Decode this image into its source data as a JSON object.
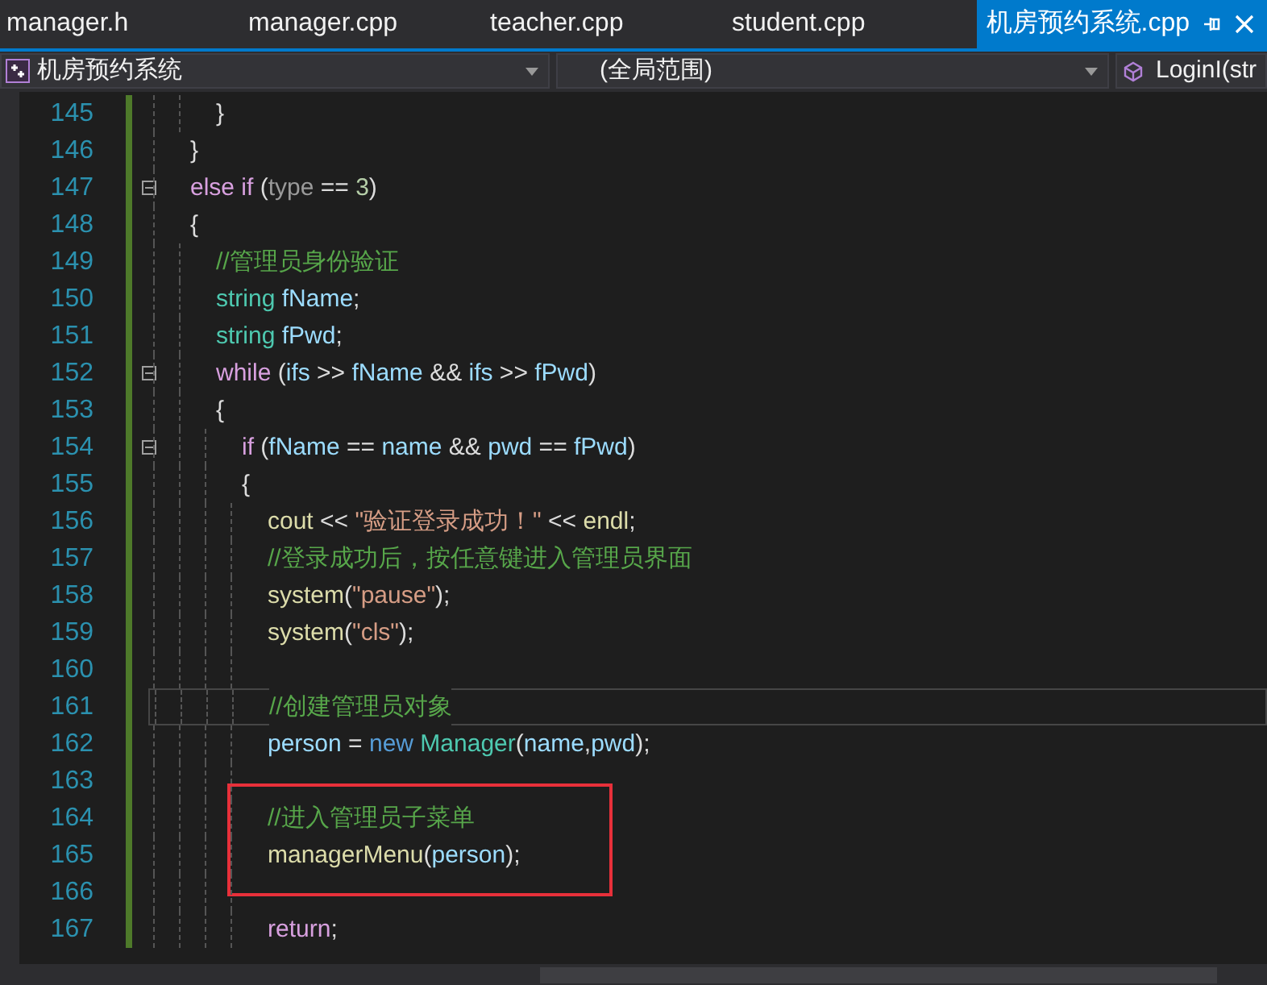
{
  "tabs": [
    {
      "label": "manager.h",
      "selected": false
    },
    {
      "label": "manager.cpp",
      "selected": false
    },
    {
      "label": "teacher.cpp",
      "selected": false
    },
    {
      "label": "student.cpp",
      "selected": false
    },
    {
      "label": "机房预约系统.cpp",
      "selected": true
    }
  ],
  "navigation": {
    "project": "机房预约系统",
    "scope": "(全局范围)",
    "member": "LoginI(str"
  },
  "editor": {
    "lines": [
      {
        "number": "145",
        "kind": "body",
        "fold": false,
        "current": false,
        "boxed": false,
        "tokens": [
          {
            "kind": "plain",
            "text": "}"
          }
        ]
      },
      {
        "number": "146",
        "kind": "outer",
        "fold": false,
        "current": false,
        "boxed": false,
        "tokens": [
          {
            "kind": "plain",
            "text": "}"
          }
        ]
      },
      {
        "number": "147",
        "kind": "outer",
        "fold": true,
        "current": false,
        "boxed": false,
        "tokens": [
          {
            "kind": "control",
            "text": "else if"
          },
          {
            "kind": "plain",
            "text": " ("
          },
          {
            "kind": "param",
            "text": "type"
          },
          {
            "kind": "plain",
            "text": " == "
          },
          {
            "kind": "number",
            "text": "3"
          },
          {
            "kind": "plain",
            "text": ")"
          }
        ]
      },
      {
        "number": "148",
        "kind": "outer",
        "fold": false,
        "current": false,
        "boxed": false,
        "tokens": [
          {
            "kind": "plain",
            "text": "{"
          }
        ]
      },
      {
        "number": "149",
        "kind": "body",
        "fold": false,
        "current": false,
        "boxed": false,
        "tokens": [
          {
            "kind": "comment",
            "text": "//管理员身份验证"
          }
        ]
      },
      {
        "number": "150",
        "kind": "body",
        "fold": false,
        "current": false,
        "boxed": false,
        "tokens": [
          {
            "kind": "type",
            "text": "string"
          },
          {
            "kind": "variable",
            "text": " fName"
          },
          {
            "kind": "plain",
            "text": ";"
          }
        ]
      },
      {
        "number": "151",
        "kind": "body",
        "fold": false,
        "current": false,
        "boxed": false,
        "tokens": [
          {
            "kind": "type",
            "text": "string"
          },
          {
            "kind": "variable",
            "text": " fPwd"
          },
          {
            "kind": "plain",
            "text": ";"
          }
        ]
      },
      {
        "number": "152",
        "kind": "body",
        "fold": true,
        "current": false,
        "boxed": false,
        "tokens": [
          {
            "kind": "control",
            "text": "while"
          },
          {
            "kind": "plain",
            "text": " ("
          },
          {
            "kind": "variable",
            "text": "ifs"
          },
          {
            "kind": "plain",
            "text": " >> "
          },
          {
            "kind": "variable",
            "text": "fName"
          },
          {
            "kind": "plain",
            "text": " && "
          },
          {
            "kind": "variable",
            "text": "ifs"
          },
          {
            "kind": "plain",
            "text": " >> "
          },
          {
            "kind": "variable",
            "text": "fPwd"
          },
          {
            "kind": "plain",
            "text": ")"
          }
        ]
      },
      {
        "number": "153",
        "kind": "body",
        "fold": false,
        "current": false,
        "boxed": false,
        "tokens": [
          {
            "kind": "plain",
            "text": "{"
          }
        ]
      },
      {
        "number": "154",
        "kind": "inner",
        "fold": true,
        "current": false,
        "boxed": false,
        "tokens": [
          {
            "kind": "control",
            "text": "if"
          },
          {
            "kind": "plain",
            "text": " ("
          },
          {
            "kind": "variable",
            "text": "fName"
          },
          {
            "kind": "plain",
            "text": " == "
          },
          {
            "kind": "variable",
            "text": "name"
          },
          {
            "kind": "plain",
            "text": " && "
          },
          {
            "kind": "variable",
            "text": "pwd"
          },
          {
            "kind": "plain",
            "text": " == "
          },
          {
            "kind": "variable",
            "text": "fPwd"
          },
          {
            "kind": "plain",
            "text": ")"
          }
        ]
      },
      {
        "number": "155",
        "kind": "inner",
        "fold": false,
        "current": false,
        "boxed": false,
        "tokens": [
          {
            "kind": "plain",
            "text": "{"
          }
        ]
      },
      {
        "number": "156",
        "kind": "deep",
        "fold": false,
        "current": false,
        "boxed": false,
        "tokens": [
          {
            "kind": "function",
            "text": "cout"
          },
          {
            "kind": "plain",
            "text": " << "
          },
          {
            "kind": "string",
            "text": "\"验证登录成功！\""
          },
          {
            "kind": "plain",
            "text": " << "
          },
          {
            "kind": "function",
            "text": "endl"
          },
          {
            "kind": "plain",
            "text": ";"
          }
        ]
      },
      {
        "number": "157",
        "kind": "deep",
        "fold": false,
        "current": false,
        "boxed": false,
        "tokens": [
          {
            "kind": "comment",
            "text": "//登录成功后，按任意键进入管理员界面"
          }
        ]
      },
      {
        "number": "158",
        "kind": "deep",
        "fold": false,
        "current": false,
        "boxed": false,
        "tokens": [
          {
            "kind": "function",
            "text": "system"
          },
          {
            "kind": "plain",
            "text": "("
          },
          {
            "kind": "string",
            "text": "\"pause\""
          },
          {
            "kind": "plain",
            "text": ");"
          }
        ]
      },
      {
        "number": "159",
        "kind": "deep",
        "fold": false,
        "current": false,
        "boxed": false,
        "tokens": [
          {
            "kind": "function",
            "text": "system"
          },
          {
            "kind": "plain",
            "text": "("
          },
          {
            "kind": "string",
            "text": "\"cls\""
          },
          {
            "kind": "plain",
            "text": ");"
          }
        ]
      },
      {
        "number": "160",
        "kind": "deep",
        "fold": false,
        "current": false,
        "boxed": false
      },
      {
        "number": "161",
        "kind": "deep",
        "fold": false,
        "current": true,
        "boxed": false,
        "tokens": [
          {
            "kind": "comment",
            "text": "//创建管理员对象"
          }
        ]
      },
      {
        "number": "162",
        "kind": "deep",
        "fold": false,
        "current": false,
        "boxed": false,
        "tokens": [
          {
            "kind": "variable",
            "text": "person"
          },
          {
            "kind": "plain",
            "text": " = "
          },
          {
            "kind": "keyword",
            "text": "new"
          },
          {
            "kind": "type",
            "text": " Manager"
          },
          {
            "kind": "plain",
            "text": "("
          },
          {
            "kind": "variable",
            "text": "name"
          },
          {
            "kind": "plain",
            "text": ","
          },
          {
            "kind": "variable",
            "text": "pwd"
          },
          {
            "kind": "plain",
            "text": ");"
          }
        ]
      },
      {
        "number": "163",
        "kind": "deep",
        "fold": false,
        "current": false,
        "boxed": false
      },
      {
        "number": "164",
        "kind": "deep",
        "fold": false,
        "current": false,
        "boxed": true,
        "tokens": [
          {
            "kind": "comment",
            "text": "//进入管理员子菜单"
          }
        ]
      },
      {
        "number": "165",
        "kind": "deep",
        "fold": false,
        "current": false,
        "boxed": true,
        "tokens": [
          {
            "kind": "function",
            "text": "managerMenu"
          },
          {
            "kind": "plain",
            "text": "("
          },
          {
            "kind": "variable",
            "text": "person"
          },
          {
            "kind": "plain",
            "text": ");"
          }
        ]
      },
      {
        "number": "166",
        "kind": "deep",
        "fold": false,
        "current": false,
        "boxed": false
      },
      {
        "number": "167",
        "kind": "deep",
        "fold": false,
        "current": false,
        "boxed": false,
        "tokens": [
          {
            "kind": "control",
            "text": "return"
          },
          {
            "kind": "plain",
            "text": ";"
          }
        ]
      }
    ]
  }
}
